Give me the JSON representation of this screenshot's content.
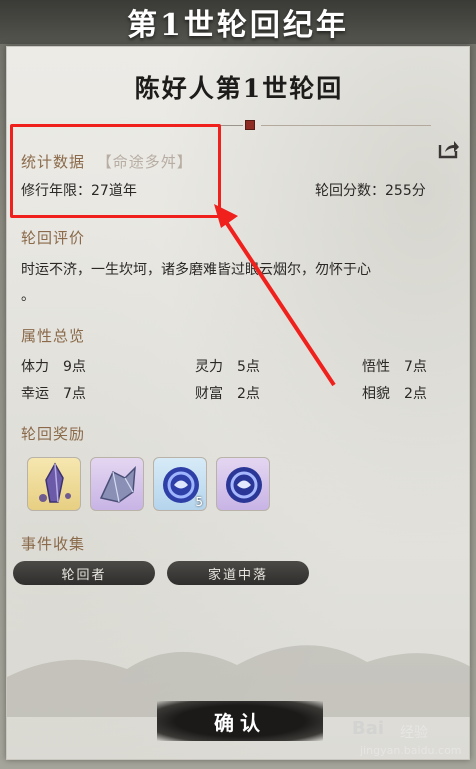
{
  "header": {
    "title": "第1世轮回纪年"
  },
  "card": {
    "title": "陈好人第1世轮回"
  },
  "stats": {
    "label": "统计数据",
    "sub_label": "【命途多舛】",
    "years_label": "修行年限：",
    "years_value": "27道年",
    "score_label": "轮回分数：",
    "score_value": "255分"
  },
  "evaluation": {
    "label": "轮回评价",
    "line1": "时运不济，一生坎坷，诸多磨难皆过眼云烟尔，勿怀于心",
    "line2": "。"
  },
  "attributes": {
    "label": "属性总览",
    "items": [
      {
        "name": "体力",
        "value": "9点"
      },
      {
        "name": "灵力",
        "value": "5点"
      },
      {
        "name": "悟性",
        "value": "7点"
      },
      {
        "name": "幸运",
        "value": "7点"
      },
      {
        "name": "财富",
        "value": "2点"
      },
      {
        "name": "相貌",
        "value": "2点"
      }
    ]
  },
  "rewards": {
    "label": "轮回奖励",
    "items": [
      {
        "icon": "gold-crystal-icon",
        "count": ""
      },
      {
        "icon": "violet-crystal-icon",
        "count": ""
      },
      {
        "icon": "blue-orb-icon",
        "count": "5"
      },
      {
        "icon": "purple-orb-icon",
        "count": ""
      }
    ]
  },
  "events": {
    "label": "事件收集",
    "tags": [
      "轮回者",
      "家道中落"
    ]
  },
  "confirm_label": "确认",
  "watermark": {
    "brand": "Bai",
    "sub": "经验",
    "url": "jingyan.baidu.com"
  },
  "colors": {
    "accent_label": "#8a6a4a",
    "highlight": "#f0201c",
    "seal": "#8e2b22"
  }
}
